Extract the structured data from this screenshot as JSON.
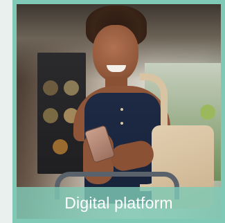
{
  "card": {
    "caption": "Digital platform",
    "border_color": "#7fc9b6",
    "caption_bg": "#7fc9b6",
    "caption_text_color": "#ffffff"
  },
  "image": {
    "subject": "woman-with-smartphone-in-store-photo"
  }
}
